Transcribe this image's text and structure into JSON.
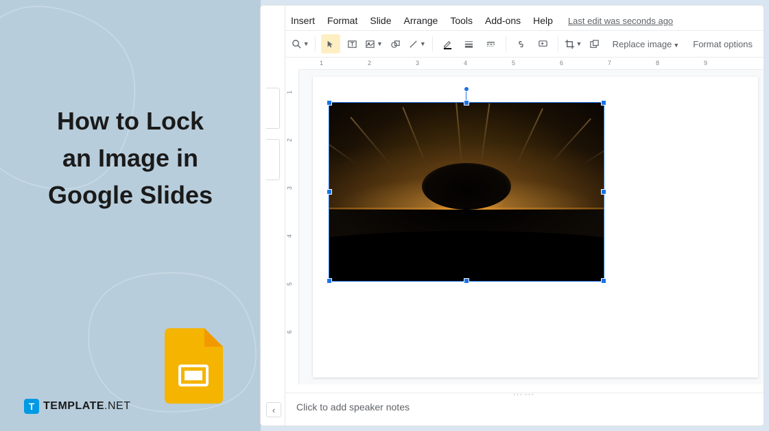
{
  "left": {
    "title_line1": "How to Lock",
    "title_line2": "an Image in",
    "title_line3": "Google Slides",
    "brand_text": "TEMPLATE",
    "brand_suffix": ".NET"
  },
  "menus": {
    "insert": "Insert",
    "format": "Format",
    "slide": "Slide",
    "arrange": "Arrange",
    "tools": "Tools",
    "addons": "Add-ons",
    "help": "Help",
    "edit_status": "Last edit was seconds ago"
  },
  "toolbar": {
    "replace_image": "Replace image",
    "format_options": "Format options"
  },
  "ruler_h": [
    "1",
    "2",
    "3",
    "4",
    "5",
    "6",
    "7",
    "8",
    "9"
  ],
  "ruler_v": [
    "1",
    "2",
    "3",
    "4",
    "5",
    "6"
  ],
  "notes": {
    "placeholder": "Click to add speaker notes"
  },
  "icons": {
    "search": "search-icon",
    "select": "select-icon",
    "textbox": "textbox-icon",
    "image": "image-icon",
    "shape": "shape-icon",
    "line": "line-icon",
    "border_color": "border-color-icon",
    "border_weight": "border-weight-icon",
    "border_dash": "border-dash-icon",
    "link": "link-icon",
    "comment": "comment-icon",
    "crop": "crop-icon",
    "mask": "mask-icon",
    "reset": "reset-icon"
  }
}
